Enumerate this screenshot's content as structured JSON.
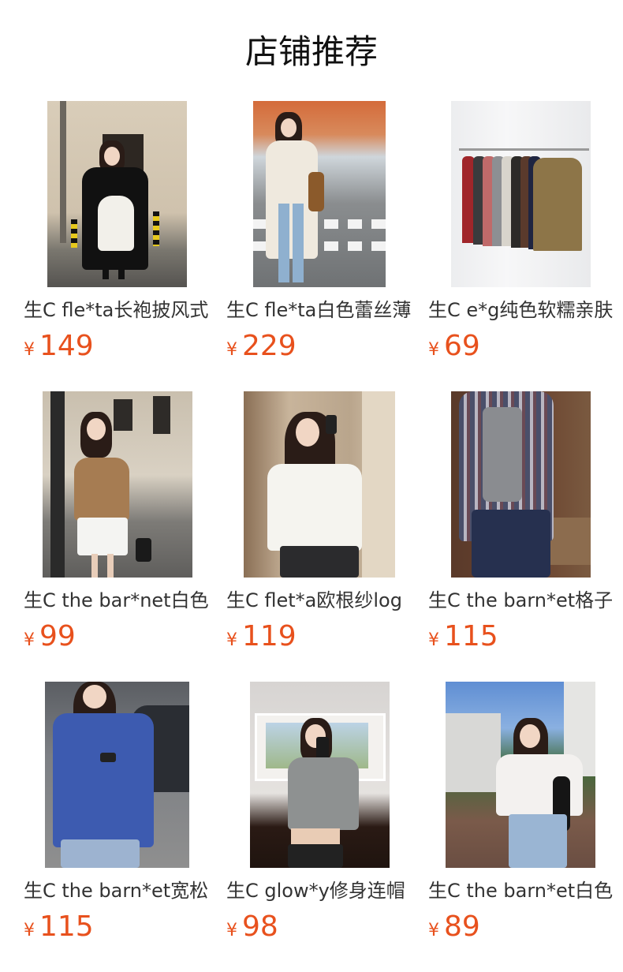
{
  "page": {
    "title": "店铺推荐"
  },
  "currency_symbol": "¥",
  "products": [
    {
      "title": "生C fle*ta长袍披风式",
      "price": "149",
      "image": "photo-woman-black-long-coat-doorway"
    },
    {
      "title": "生C fle*ta白色蕾丝薄",
      "price": "229",
      "image": "photo-woman-white-lace-coat-street"
    },
    {
      "title": "生C e*g纯色软糯亲肤",
      "price": "69",
      "image": "photo-turtlenecks-on-rack"
    },
    {
      "title": "生C the bar*net白色",
      "price": "99",
      "image": "photo-woman-brown-cardigan-white-skirt"
    },
    {
      "title": "生C flet*a欧根纱log",
      "price": "119",
      "image": "photo-woman-white-shirt-mirror-selfie"
    },
    {
      "title": "生C the barn*et格子",
      "price": "115",
      "image": "photo-plaid-shirt-grey-tank"
    },
    {
      "title": "生C the barn*et宽松",
      "price": "115",
      "image": "photo-woman-blue-shirt-street"
    },
    {
      "title": "生C glow*y修身连帽",
      "price": "98",
      "image": "photo-woman-grey-top-mirror-selfie"
    },
    {
      "title": "生C the barn*et白色",
      "price": "89",
      "image": "photo-woman-white-cardigan-outdoor"
    }
  ],
  "colors": {
    "price": "#e8511d",
    "title_text": "#333333",
    "heading": "#111111"
  }
}
